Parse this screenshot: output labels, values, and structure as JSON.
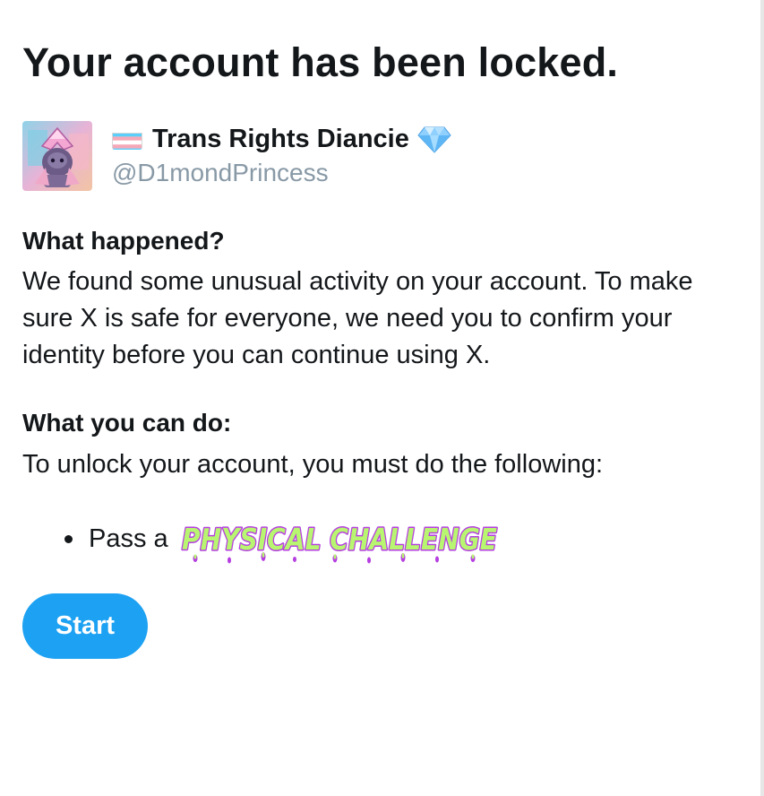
{
  "page": {
    "title": "Your account has been locked."
  },
  "account": {
    "display_name": "Trans Rights Diancie",
    "handle": "@D1mondPrincess",
    "flag_icon": "transgender-flag-emoji",
    "badge_icon": "gem-stone-emoji"
  },
  "what_happened": {
    "heading": "What happened?",
    "body": "We found some unusual activity on your account. To make sure X is safe for everyone, we need you to confirm your identity before you can continue using X."
  },
  "what_you_can_do": {
    "heading": "What you can do:",
    "body": "To unlock your account, you must do the following:",
    "steps": [
      {
        "prefix": "Pass a",
        "art_text": "PHYSICAL CHALLENGE"
      }
    ]
  },
  "actions": {
    "start_label": "Start"
  },
  "colors": {
    "accent": "#1da1f2",
    "text": "#14171a",
    "muted": "#8899a6",
    "art_fill": "#b8f570",
    "art_outline": "#b53ee0"
  }
}
